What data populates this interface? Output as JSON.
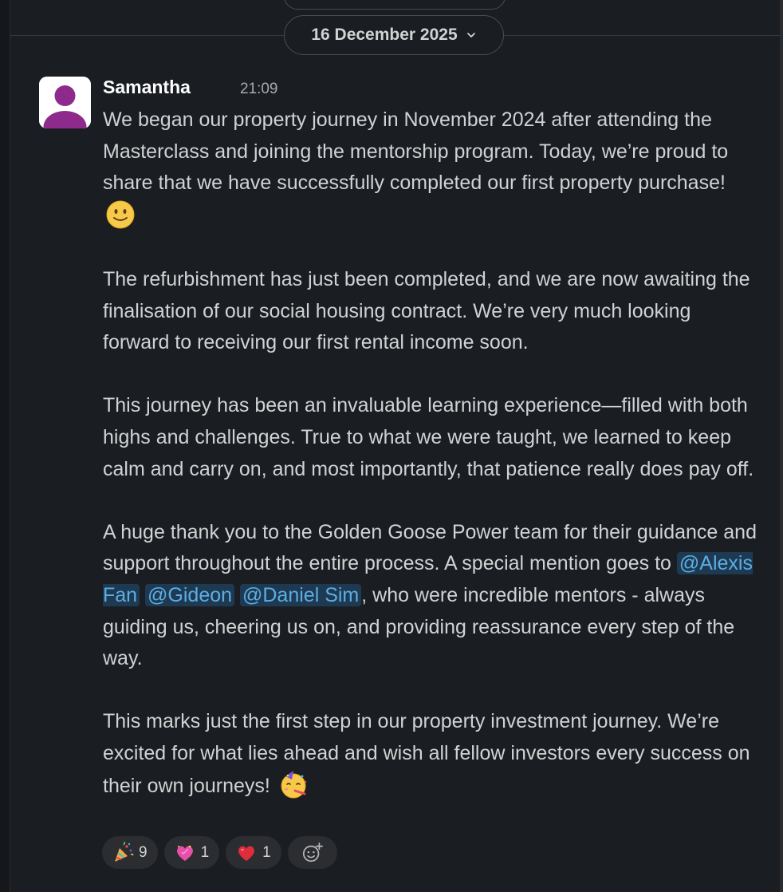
{
  "date_divider": {
    "label": "16 December 2025"
  },
  "message": {
    "author": "Samantha",
    "time": "21:09",
    "paragraphs": {
      "p1": "We began our property journey in November 2024 after attending the Masterclass and joining the mentorship program. Today, we’re proud to share that we have successfully completed our first property purchase!",
      "p2": "The refurbishment has just been completed, and we are now awaiting the finalisation of our social housing contract. We’re very much looking forward to receiving our first rental income soon.",
      "p3": "This journey has been an invaluable learning experience—filled with both highs and challenges. True to what we were taught, we learned to keep calm and carry on, and most importantly, that patience really does pay off.",
      "p4_before": "A huge thank you to the Golden Goose Power team for their guidance and support throughout the entire process. A special mention goes to ",
      "p4_after": ", who were incredible mentors - always guiding us, cheering us on, and providing reassurance every step of the way.",
      "p5": "This marks just the first step in our property investment journey. We’re excited for what lies ahead and wish all fellow investors every success on their own journeys!"
    },
    "mentions": [
      "@Alexis Fan",
      "@Gideon",
      "@Daniel Sim"
    ],
    "reactions": [
      {
        "emoji": "party-popper-icon",
        "count": "9"
      },
      {
        "emoji": "pink-heart-icon",
        "count": "1"
      },
      {
        "emoji": "red-heart-icon",
        "count": "1"
      }
    ]
  },
  "colors": {
    "background": "#1a1d21",
    "mention_bg": "#1d3a52",
    "mention_text": "#5dade2",
    "avatar_purple": "#8e2a8c"
  }
}
